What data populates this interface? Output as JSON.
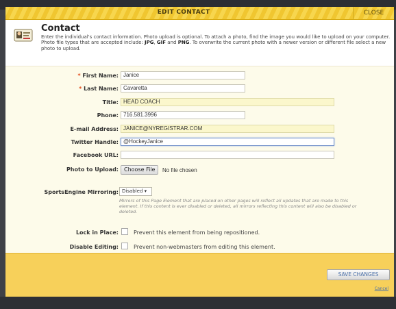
{
  "dialog": {
    "title": "EDIT CONTACT",
    "close_label": "CLOSE"
  },
  "header": {
    "icon": "contact-card-icon",
    "title": "Contact",
    "description_parts": [
      "Enter the individual's contact information. Photo upload is optional. To attach a photo, find the image you would like to upload on your computer. Photo file types that are accepted include: ",
      "JPG",
      ", ",
      "GIF",
      " and ",
      "PNG",
      ". To overwrite the current photo with a newer version or different file select a new photo to upload."
    ]
  },
  "fields": {
    "first_name": {
      "label": "First Name:",
      "required_mark": "*",
      "value": "Janice"
    },
    "last_name": {
      "label": "Last Name:",
      "required_mark": "*",
      "value": "Cavaretta"
    },
    "title": {
      "label": "Title:",
      "value": "HEAD COACH"
    },
    "phone": {
      "label": "Phone:",
      "value": "716.581.3996"
    },
    "email": {
      "label": "E-mail Address:",
      "value": "JANICE@NYREGISTRAR.COM"
    },
    "twitter": {
      "label": "Twitter Handle:",
      "value": "@HockeyJanice"
    },
    "facebook": {
      "label": "Facebook URL:",
      "value": ""
    },
    "photo": {
      "label": "Photo to Upload:",
      "button_label": "Choose File",
      "status": "No file chosen"
    }
  },
  "mirroring": {
    "label": "SportsEngine Mirroring:",
    "selected": "Disabled",
    "note": "Mirrors of this Page Element that are placed on other pages will reflect all updates that are made to this element. If this content is ever disabled or deleted, all mirrors reflecting this content will also be disabled or deleted."
  },
  "lock": {
    "label": "Lock in Place:",
    "text": "Prevent this element from being repositioned.",
    "checked": false
  },
  "disable_editing": {
    "label": "Disable Editing:",
    "text": "Prevent non-webmasters from editing this element.",
    "checked": false
  },
  "footer": {
    "save_label": "SAVE CHANGES",
    "cancel_label": "Cancel"
  }
}
